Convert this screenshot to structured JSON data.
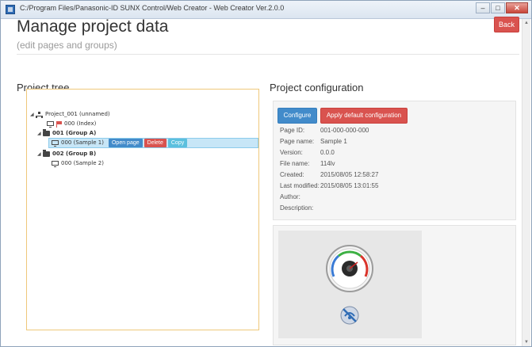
{
  "window": {
    "title": "C:/Program Files/Panasonic-ID SUNX Control/Web Creator - Web Creator Ver.2.0.0",
    "minimize_glyph": "–",
    "maximize_glyph": "□",
    "close_glyph": "✕"
  },
  "header": {
    "title": "Manage project data",
    "subtitle": "(edit pages and groups)",
    "back_label": "Back"
  },
  "tree": {
    "heading": "Project tree",
    "project": {
      "label": "Project_001 (unnamed)",
      "icon": "sitemap-icon"
    },
    "index_page": {
      "label": "000 (Index)",
      "icon": "flag-icon"
    },
    "group_a": {
      "label": "001 (Group A)",
      "icon": "folder-icon"
    },
    "sample1": {
      "label": "000 (Sample 1)",
      "icon": "monitor-icon",
      "selected": true
    },
    "group_b": {
      "label": "002 (Group B)",
      "icon": "folder-icon"
    },
    "sample2": {
      "label": "000 (Sample 2)",
      "icon": "monitor-icon"
    },
    "actions": {
      "open": "Open page",
      "delete": "Delete",
      "copy": "Copy"
    },
    "border_color": "#efc87b",
    "selection_color": "#c7e6f7"
  },
  "config": {
    "heading": "Project configuration",
    "configure_label": "Configure",
    "apply_default_label": "Apply default configuration",
    "fields": [
      {
        "label": "Page ID:",
        "value": "001-000-000-000"
      },
      {
        "label": "Page name:",
        "value": "Sample 1"
      },
      {
        "label": "Version:",
        "value": "0.0.0"
      },
      {
        "label": "File name:",
        "value": "114lv"
      },
      {
        "label": "Created:",
        "value": "2015/08/05 12:58:27"
      },
      {
        "label": "Last modified:",
        "value": "2015/08/05 13:01:55"
      },
      {
        "label": "Author:",
        "value": ""
      },
      {
        "label": "Description:",
        "value": ""
      }
    ]
  },
  "preview": {
    "widgets": [
      "gauge-icon",
      "no-connection-icon"
    ]
  },
  "colors": {
    "primary": "#428bca",
    "danger": "#d9534f",
    "info": "#5bc0de"
  }
}
